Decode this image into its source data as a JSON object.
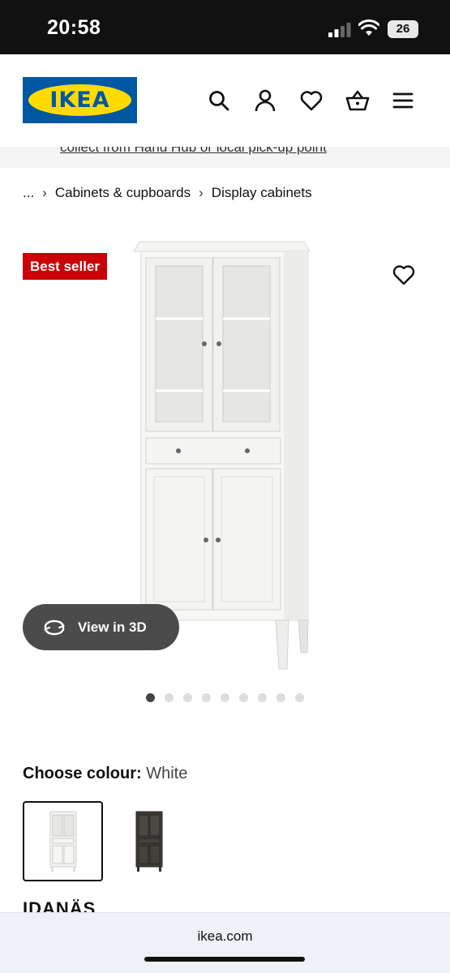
{
  "status_bar": {
    "time": "20:58",
    "battery": "26"
  },
  "header": {
    "logo_text": "IKEA"
  },
  "promo": {
    "text": "collect from Hand Hub or local pick-up point"
  },
  "breadcrumb": {
    "ellipsis": "...",
    "items": [
      "Cabinets & cupboards",
      "Display cabinets"
    ]
  },
  "product": {
    "badge": "Best seller",
    "view_3d_label": "View in 3D",
    "image_count": 9,
    "active_image": 1,
    "colour_label": "Choose colour:",
    "colour_value": "White",
    "swatches": [
      "White",
      "Dark brown"
    ],
    "title": "IDANÄS"
  },
  "browser": {
    "url": "ikea.com"
  },
  "colors": {
    "ikea_blue": "#0058a3",
    "ikea_yellow": "#ffdb00",
    "badge_red": "#cc0008"
  }
}
